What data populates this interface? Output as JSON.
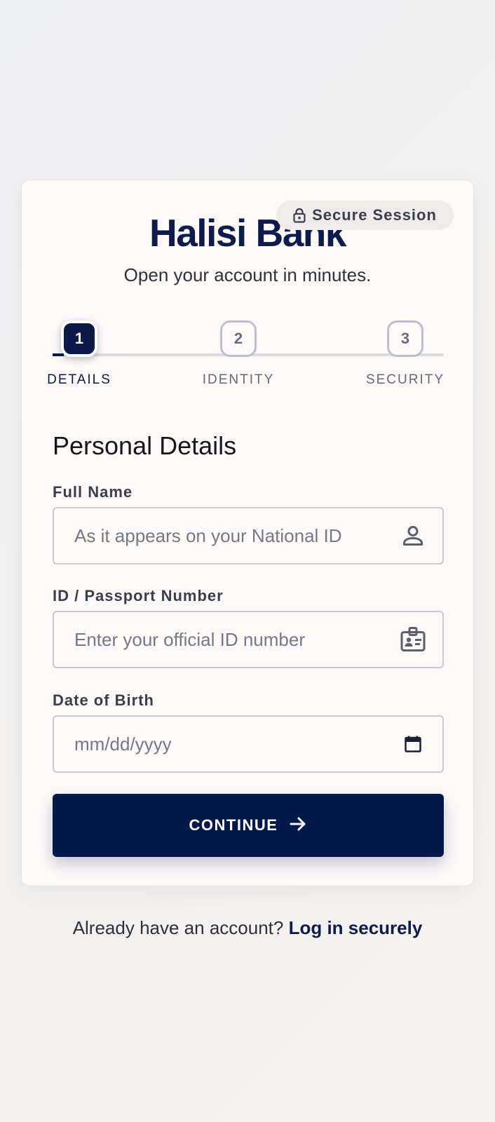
{
  "header": {
    "badge_label": "Secure Session",
    "brand": "Halisi Bank",
    "tagline": "Open your account in minutes."
  },
  "stepper": {
    "current_step": 1,
    "steps": [
      {
        "number": "1",
        "label": "DETAILS",
        "state": "active"
      },
      {
        "number": "2",
        "label": "IDENTITY",
        "state": "pending"
      },
      {
        "number": "3",
        "label": "SECURITY",
        "state": "pending"
      }
    ]
  },
  "form": {
    "section_title": "Personal Details",
    "full_name": {
      "label": "Full Name",
      "placeholder": "As it appears on your National ID",
      "value": "",
      "icon": "person-icon"
    },
    "id_number": {
      "label": "ID / Passport Number",
      "placeholder": "Enter your official ID number",
      "value": "",
      "icon": "id-card-icon"
    },
    "dob": {
      "label": "Date of Birth",
      "placeholder": "mm/dd/yyyy",
      "value": "",
      "icon": "calendar-icon"
    },
    "continue_label": "CONTINUE",
    "continue_icon": "arrow-right-icon"
  },
  "footer": {
    "prompt": "Already have an account?",
    "link_label": "Log in securely"
  },
  "colors": {
    "primary": "#02194a",
    "brand_text": "#0f1c4b",
    "card_background": "#fcf9f8",
    "input_border": "#c7c9d3"
  }
}
